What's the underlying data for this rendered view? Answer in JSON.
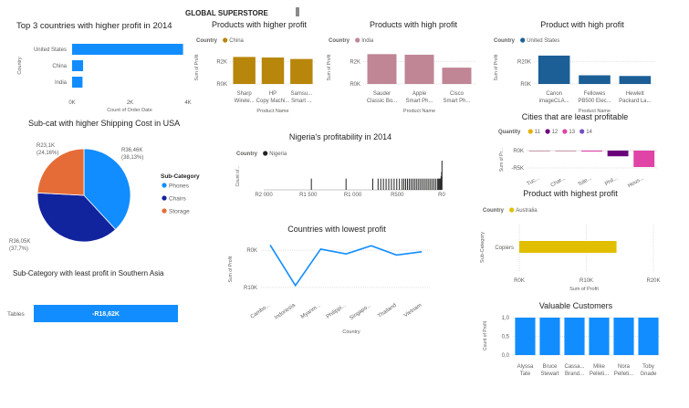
{
  "dashboard_title": "GLOBAL SUPERSTORE",
  "colors": {
    "blue": "#118DFF",
    "navy": "#12239E",
    "orange": "#E66C37",
    "gold": "#B8860B",
    "mauve": "#C08696",
    "darkblue": "#1B5F96",
    "yellow": "#E1BF00",
    "black": "#252423"
  },
  "chart_data": [
    {
      "id": "top3",
      "type": "bar",
      "orientation": "horizontal",
      "title": "Top 3 countries with higher profit in 2014",
      "categories": [
        "United States",
        "China",
        "India"
      ],
      "values": [
        3830,
        380,
        360
      ],
      "xlabel": "Count of Order Date",
      "ylabel": "Country",
      "xlim": [
        0,
        4000
      ],
      "xticks": [
        "0K",
        "2K",
        "4K"
      ]
    },
    {
      "id": "china",
      "type": "bar",
      "title": "Products with higher profit",
      "legend_title": "Country",
      "legend": [
        "China"
      ],
      "categories": [
        "Sharp Wirele...",
        "HP Copy Machi...",
        "Samsu... Smart ..."
      ],
      "values": [
        2400,
        2350,
        2220
      ],
      "xlabel": "Product Name",
      "ylabel": "Sum of Profit",
      "ylim": [
        0,
        3000
      ],
      "yticks": [
        "R0K",
        "R2K"
      ]
    },
    {
      "id": "india",
      "type": "bar",
      "title": "Products with high profit",
      "legend_title": "Country",
      "legend": [
        "India"
      ],
      "categories": [
        "Sauder Classic Bo...",
        "Apple Smart Ph...",
        "Cisco Smart Ph..."
      ],
      "values": [
        2650,
        2600,
        1450
      ],
      "xlabel": "Product Name",
      "ylabel": "Sum of Profit",
      "ylim": [
        0,
        3000
      ],
      "yticks": [
        "R0K",
        "R2K"
      ]
    },
    {
      "id": "us",
      "type": "bar",
      "title": "Product with high profit",
      "legend_title": "Country",
      "legend": [
        "United States"
      ],
      "categories": [
        "Canon imageCLA...",
        "Fellowes PB500 Elec...",
        "Hewlett Packard La..."
      ],
      "values": [
        25200,
        7700,
        7100
      ],
      "xlabel": "Product Name",
      "ylabel": "Sum of Profit",
      "ylim": [
        0,
        30000
      ],
      "yticks": [
        "R0K",
        "R20K"
      ]
    },
    {
      "id": "pie",
      "type": "pie",
      "title": "Sub-cat with higher Shipping Cost in USA",
      "legend_title": "Sub-Category",
      "labels": [
        "Phones",
        "Chairs",
        "Storage"
      ],
      "values": [
        36460,
        36050,
        23100
      ],
      "percents": [
        38.13,
        37.7,
        24.16
      ],
      "data_labels": [
        "R36,46K (38,13%)",
        "R36,05K (37,7%)",
        "R23,1K (24,16%)"
      ]
    },
    {
      "id": "nigeria",
      "type": "bar",
      "title": "Nigeria's profitability in 2014",
      "legend_title": "Country",
      "legend": [
        "Nigeria"
      ],
      "ylabel": "Count of...",
      "xlim": [
        -2000,
        0
      ],
      "xticks": [
        "R2 000",
        "R1 500",
        "R1 000",
        "R500",
        "R0"
      ],
      "x": [
        -1470,
        -1080,
        -780,
        -720,
        -690,
        -660,
        -630,
        -600,
        -570,
        -540,
        -510,
        -480,
        -450,
        -430,
        -410,
        -390,
        -370,
        -350,
        -330,
        -310,
        -290,
        -270,
        -250,
        -230,
        -210,
        -190,
        -170,
        -150,
        -130,
        -110,
        -90,
        -70,
        -50,
        -40,
        -30,
        -20,
        -12,
        -6,
        -2
      ],
      "y": [
        1,
        1,
        1,
        1,
        1,
        1,
        1,
        1,
        1,
        1,
        1,
        1,
        1,
        1,
        1,
        1,
        1,
        1,
        1,
        1,
        1,
        1,
        1,
        1,
        1,
        1,
        1,
        1,
        1,
        1,
        1,
        1,
        1,
        1,
        1,
        1,
        1.2,
        1.6,
        2.6
      ]
    },
    {
      "id": "cities",
      "type": "bar",
      "title": "Cities that are least profitable",
      "legend_title": "Quantity",
      "legend": [
        "11",
        "12",
        "13",
        "14"
      ],
      "legend_colors": [
        "#E8B100",
        "#6B007B",
        "#E044A7",
        "#744EC2"
      ],
      "categories": [
        "Tuc...",
        "Char...",
        "Tole...",
        "Phil...",
        "Hous..."
      ],
      "bar_colors": [
        "#C08696",
        "#C08696",
        "#E044A7",
        "#6B007B",
        "#E044A7"
      ],
      "values": [
        -100,
        -200,
        -300,
        -1800,
        -5200
      ],
      "ylabel": "Sum of Pr...",
      "ylim": [
        -6000,
        0
      ],
      "yticks": [
        "R0K",
        "-R5K"
      ]
    },
    {
      "id": "australia",
      "type": "bar",
      "orientation": "horizontal",
      "title": "Product with highest profit",
      "legend_title": "Country",
      "legend": [
        "Australia"
      ],
      "categories": [
        "Copiers"
      ],
      "values": [
        14500
      ],
      "xlabel": "Sum of Profit",
      "ylabel": "Sub-Category",
      "xlim": [
        0,
        20000
      ],
      "xticks": [
        "R0K",
        "R10K",
        "R20K"
      ]
    },
    {
      "id": "lowest",
      "type": "line",
      "title": "Countries with lowest profit",
      "categories": [
        "Cambo...",
        "Indonesia",
        "Myanm...",
        "Philippi...",
        "Singapo...",
        "Thailand",
        "Vietnam"
      ],
      "values": [
        1400,
        -9500,
        300,
        -1000,
        1200,
        -1300,
        -400
      ],
      "xlabel": "Country",
      "ylabel": "Sum of Profit",
      "ylim": [
        -12000,
        2000
      ],
      "yticks": [
        "R0K",
        "R10K"
      ]
    },
    {
      "id": "southasia",
      "type": "bar",
      "orientation": "horizontal",
      "title": "Sub-Category with least profit in Southern Asia",
      "categories": [
        "Tables"
      ],
      "values": [
        -18620
      ],
      "data_labels": [
        "-R18,62K"
      ]
    },
    {
      "id": "customers",
      "type": "bar",
      "title": "Valuable Customers",
      "categories": [
        "Alyssa Tate",
        "Bruce Stewart",
        "Cassa... Brand...",
        "Mike Pelleti...",
        "Nora Pelleti...",
        "Toby Gnade"
      ],
      "values": [
        1,
        1,
        1,
        1,
        1,
        1
      ],
      "ylabel": "Count of Profit",
      "ylim": [
        0,
        1
      ],
      "yticks": [
        "0,0",
        "0,5",
        "1,0"
      ]
    }
  ]
}
